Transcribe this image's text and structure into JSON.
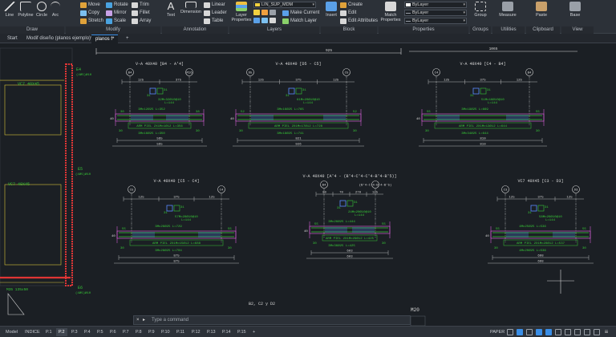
{
  "ribbon": {
    "draw": {
      "title": "Draw",
      "line": "Line",
      "polyline": "Polyline",
      "circle": "Circle",
      "arc": "Arc"
    },
    "modify": {
      "title": "Modify",
      "move": "Move",
      "rotate": "Rotate",
      "trim": "Trim",
      "copy": "Copy",
      "mirror": "Mirror",
      "fillet": "Fillet",
      "stretch": "Stretch",
      "scale": "Scale",
      "array": "Array"
    },
    "annotation": {
      "title": "Annotation",
      "text": "Text",
      "dimension": "Dimension",
      "linear": "Linear",
      "leader": "Leader",
      "table": "Table"
    },
    "layers": {
      "title": "Layers",
      "layer_properties": "Layer Properties",
      "current_layer": "LIN_SUP_MDM",
      "make_current": "Make Current",
      "match_layer": "Match Layer"
    },
    "block": {
      "title": "Block",
      "insert": "Insert",
      "create": "Create",
      "edit": "Edit",
      "edit_attributes": "Edit Attributes"
    },
    "properties": {
      "title": "Properties",
      "match_properties": "Match Properties",
      "color": "ByLayer",
      "lineweight": "ByLayer",
      "linetype": "ByLayer"
    },
    "groups": {
      "title": "Groups",
      "group": "Group"
    },
    "utilities": {
      "title": "Utilities",
      "measure": "Measure"
    },
    "clipboard": {
      "title": "Clipboard",
      "paste": "Paste"
    },
    "view": {
      "title": "View",
      "base": "Base"
    }
  },
  "doc_tabs": [
    "Start",
    "Modif diseño (planos ejemplo)*",
    "planos f*",
    "+"
  ],
  "drawing": {
    "beams": [
      {
        "title": "V-A 40X40 [B4 - A'4]",
        "axes": [
          "B4",
          "M16"
        ],
        "cota_top": [
          "125",
          "375"
        ],
        "rebar_top": [
          "3Mc12Ø25",
          "L=352"
        ],
        "rebar_mid": [
          "3Mc16Ø25",
          "L=350"
        ],
        "arm_piel": "ARM PIEL 2X1Mc1Ø12  L=356",
        "estribos": [
          "31",
          "32Mc32Ø10@10",
          "L=144"
        ],
        "cota_bottom": "565",
        "cotas_side": [
          "30",
          "38",
          "40"
        ],
        "cota_total": "565"
      },
      {
        "title": "V-A 40X40 [D5 - C5]",
        "axes": [
          "D5",
          "C5"
        ],
        "cota_top": [
          "125",
          "375",
          "125"
        ],
        "rebar_top": [
          "3Mc16Ø25",
          "L=765"
        ],
        "rebar_mid": [
          "3Mc18Ø25",
          "L=741"
        ],
        "arm_piel": "ARM PIEL 2X1Mc17Ø12  L=728",
        "estribos": [
          "31",
          "61Mc20Ø10@10",
          "L=144"
        ],
        "cota_bottom": "821",
        "cotas_side": [
          "52",
          "52",
          "30",
          "30",
          "40"
        ],
        "cota_total": "926"
      },
      {
        "title": "V-A 40X40 [C4 - B4]",
        "axes": [
          "C4",
          "B4"
        ],
        "cota_top": [
          "125",
          "375",
          "125"
        ],
        "rebar_top": [
          "3Mc19Ø25",
          "L=669"
        ],
        "rebar_mid": [
          "3Mc34Ø25",
          "L=644"
        ],
        "arm_piel": "ARM PIEL 2X1Mc13Ø12  L=644",
        "estribos": [
          "31",
          "51Mc16Ø10@10",
          "L=144"
        ],
        "cota_bottom": "810",
        "cotas_side": [
          "55",
          "55",
          "30",
          "30",
          "40"
        ],
        "cota_total": "810"
      },
      {
        "title": "V-A 40X40 [C5 - C4]",
        "axes": [
          "C5",
          "C4"
        ],
        "cota_top": [
          "125",
          "375",
          "125"
        ],
        "rebar_top": [
          "3Mc26Ø25",
          "L=729"
        ],
        "rebar_mid": [
          "3Mc28Ø25",
          "L=704"
        ],
        "arm_piel": "ARM PIEL 2X1Mc15Ø12  L=688",
        "estribos": [
          "31",
          "57Mc28Ø10@10",
          "L=144"
        ],
        "cota_bottom": "875",
        "cotas_side": [
          "55",
          "55",
          "30",
          "30",
          "40"
        ],
        "cota_total": "875"
      },
      {
        "title": "V-A 40X40 [A'4 - (B'4-C'4-C'4-B'4-B'5)]",
        "axes": [
          "B4",
          "(B'4-C'4-B'4-B'5)"
        ],
        "cota_top": [
          "80",
          "70",
          "270",
          "125"
        ],
        "rebar_top": [
          "3Mc26Ø25",
          "L=444"
        ],
        "rebar_mid": [
          "3Mc36Ø25",
          "L=425"
        ],
        "arm_piel": "ARM PIEL 2X1Mc29Ø12  L=425",
        "estribos": [
          "31",
          "24Mc20Ø10@10",
          "L=144"
        ],
        "cota_bottom": "603",
        "cotas_side": [
          "55",
          "55",
          "30",
          "30",
          "40"
        ],
        "cota_total": "603"
      },
      {
        "title": "VC7 40X45 [C3 - D3]",
        "axes": [
          "C3",
          "D3"
        ],
        "cota_top": [
          "125",
          "375",
          "125"
        ],
        "rebar_top": [
          "4Mc25Ø25",
          "L=536"
        ],
        "rebar_mid": [
          "4Mc20Ø25",
          "L=536"
        ],
        "arm_piel": "ARM PIEL 2X1Mc28Ø12  L=537",
        "estribos": [
          "31",
          "58Mc26Ø10@10",
          "L=144"
        ],
        "cota_bottom": "698",
        "cotas_side": [
          "55",
          "55",
          "30",
          "30",
          "40"
        ],
        "cota_total": "698"
      }
    ],
    "top_dims": [
      "925",
      "1065"
    ],
    "plan_labels": [
      "E4",
      "(4Ø5)Ø10",
      "VC7 40X45",
      "E5",
      "(4Ø5)Ø10",
      "VC7 40X45",
      "E6",
      "(4Ø5)Ø10",
      "M35 135x50"
    ],
    "footer_labels": [
      "B2, C2 y D2",
      "M20"
    ]
  },
  "command": {
    "placeholder": "Type a command"
  },
  "layout_tabs": [
    "Model",
    "INDICE",
    "P.1",
    "P.2",
    "P.3",
    "P.4",
    "P.5",
    "P.6",
    "P.7",
    "P.8",
    "P.9",
    "P.10",
    "P.11",
    "P.12",
    "P.13",
    "P.14",
    "P.15",
    "+"
  ],
  "active_layout": "P.2",
  "status": {
    "space": "PAPER"
  },
  "colors": {
    "accent": "#3a8ee6",
    "concrete": "#d15dd1",
    "rebar_green": "#37c837",
    "stirrup_blue": "#5a8cff",
    "plan_red": "#e03535",
    "dim_white": "#d8d8d8",
    "plan_yellow": "#d8c33a"
  }
}
